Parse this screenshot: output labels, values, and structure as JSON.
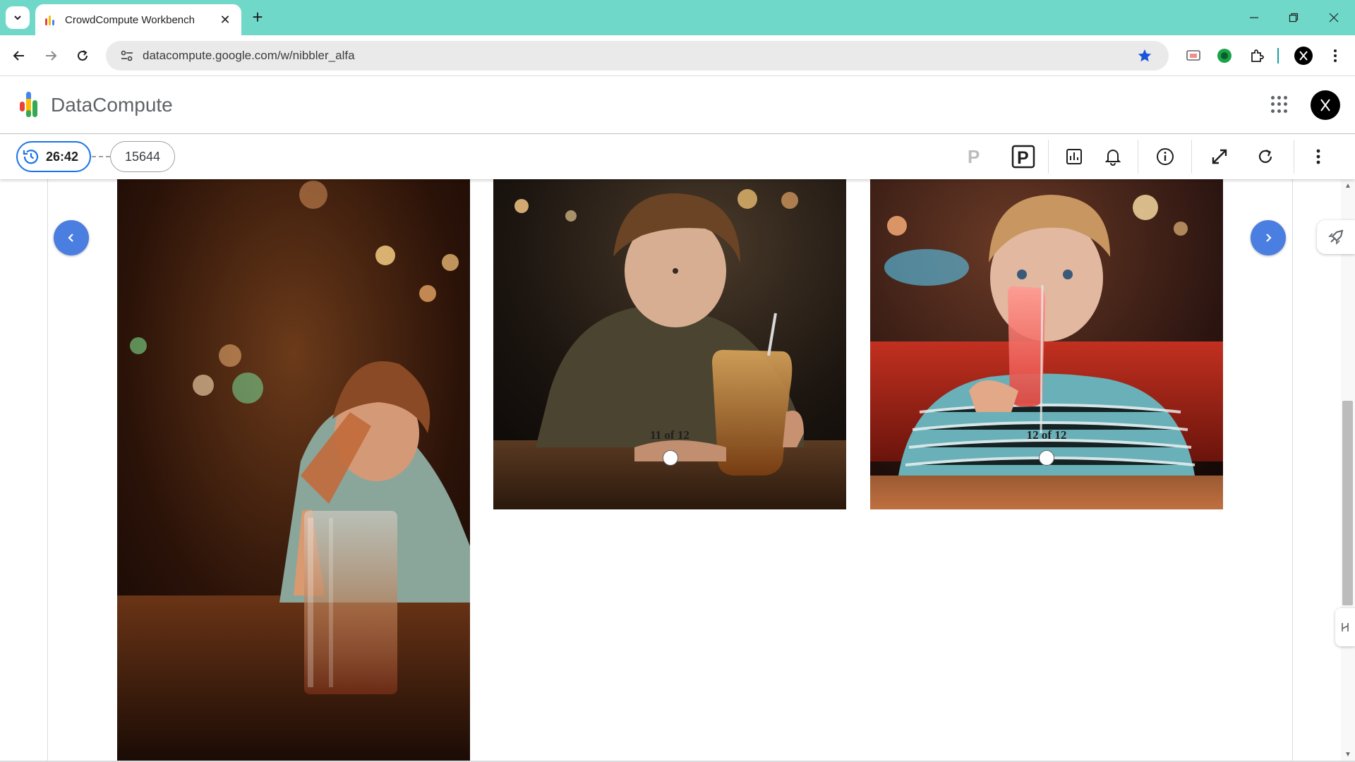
{
  "browser": {
    "tab_title": "CrowdCompute Workbench",
    "url": "datacompute.google.com/w/nibbler_alfa",
    "icons": [
      "tab-search-icon",
      "favicon-icon",
      "close-icon",
      "plus-icon",
      "minimize-icon",
      "restore-icon",
      "close-window-icon",
      "back-arrow-icon",
      "forward-arrow-icon",
      "reload-icon",
      "site-info-icon",
      "bookmark-star-icon",
      "cast-icon",
      "extension-icon",
      "puzzle-icon",
      "profile-avatar-icon",
      "kebab-menu-icon"
    ]
  },
  "app": {
    "name": "DataCompute",
    "brand_colors": [
      "#ea4335",
      "#fbbc04",
      "#34a853",
      "#4285f4"
    ]
  },
  "task_bar": {
    "timer": "26:42",
    "task_id": "15644",
    "accent": "#1a73e8",
    "tools": [
      "p-outline-icon",
      "p-boxed-icon",
      "stats-icon",
      "bell-icon",
      "info-icon",
      "expand-icon",
      "refresh-icon",
      "more-vert-icon"
    ]
  },
  "gallery": {
    "items": [
      {
        "caption": "11 of 12",
        "selected": false
      },
      {
        "caption": "12 of 12",
        "selected": false
      }
    ],
    "nav_color": "#4a7ee0"
  }
}
